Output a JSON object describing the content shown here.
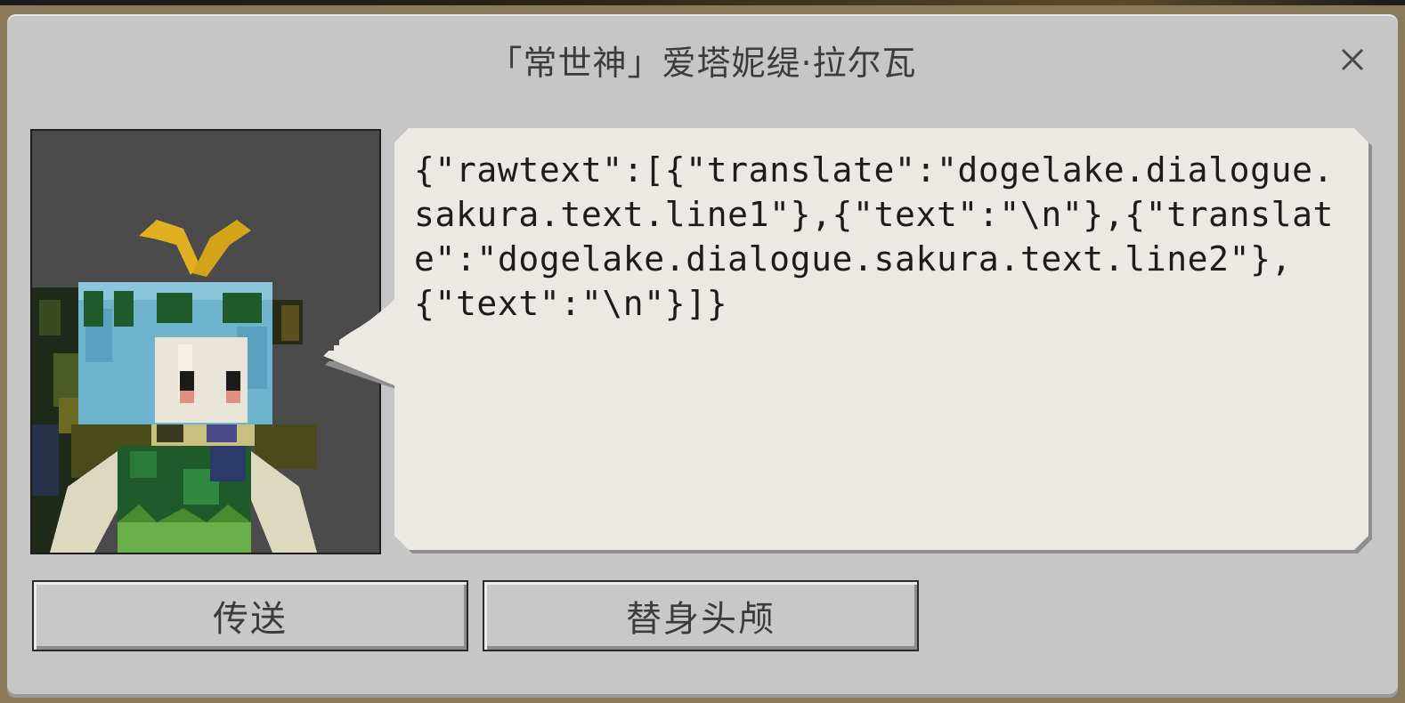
{
  "dialog": {
    "title": "「常世神」爱塔妮缇·拉尔瓦",
    "close_icon": "close-icon",
    "portrait_icon": "npc-portrait-icon",
    "message": "{\"rawtext\":[{\"translate\":\"dogelake.dialogue.sakura.text.line1\"},{\"text\":\"\\n\"},{\"translate\":\"dogelake.dialogue.sakura.text.line2\"},{\"text\":\"\\n\"}]}",
    "buttons": [
      {
        "label": "传送"
      },
      {
        "label": "替身头颅"
      }
    ]
  },
  "colors": {
    "panel": "#c6c6c6",
    "bubble": "#ece8e4",
    "portrait_bg": "#4b4b4b",
    "text": "#3c3c3c"
  }
}
